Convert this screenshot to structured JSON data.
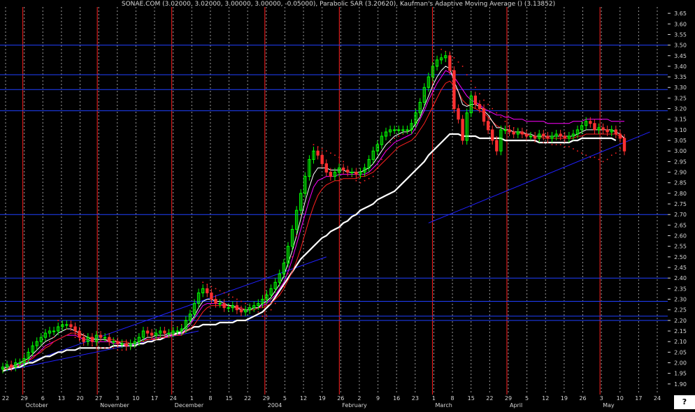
{
  "title": "SONAE.COM (3.02000, 3.02000, 3.00000, 3.00000, -0.05000), Parabolic SAR (3.20620), Kaufman's Adaptive Moving Average () (3.13852)",
  "help_label": "?",
  "colors": {
    "background": "#000000",
    "up_candle": "#00ff00",
    "down_candle": "#ff3030",
    "grid_vertical": "#9a9a9a",
    "grid_month": "#ff2020",
    "hline": "#2040ff",
    "sar": "#ff2020",
    "kama": "#ff00ff",
    "fast_ma": "#ffffff",
    "mid_ma": "#ff2020",
    "slow_ma": "#ffffff",
    "trendline": "#2020ff",
    "axis_text": "#d8d8d8"
  },
  "chart_data": {
    "type": "candlestick",
    "title": "SONAE.COM (3.02000, 3.02000, 3.00000, 3.00000, -0.05000), Parabolic SAR (3.20620), Kaufman's Adaptive Moving Average () (3.13852)",
    "ylim": [
      1.85,
      3.68
    ],
    "y_ticks": [
      "3.65",
      "3.60",
      "3.55",
      "3.50",
      "3.45",
      "3.40",
      "3.35",
      "3.30",
      "3.25",
      "3.20",
      "3.15",
      "3.10",
      "3.05",
      "3.00",
      "2.95",
      "2.90",
      "2.85",
      "2.80",
      "2.75",
      "2.70",
      "2.65",
      "2.60",
      "2.55",
      "2.50",
      "2.45",
      "2.40",
      "2.35",
      "2.30",
      "2.25",
      "2.20",
      "2.15",
      "2.10",
      "2.05",
      "2.00",
      "1.95",
      "1.90"
    ],
    "x_day_labels": [
      "22",
      "29",
      "6",
      "13",
      "20",
      "27",
      "3",
      "10",
      "17",
      "24",
      "1",
      "8",
      "15",
      "22",
      "29",
      "5",
      "12",
      "19",
      "26",
      "2",
      "9",
      "16",
      "23",
      "1",
      "8",
      "15",
      "22",
      "29",
      "5",
      "12",
      "19",
      "26",
      "3",
      "10",
      "17",
      "24"
    ],
    "x_month_labels": [
      "October",
      "November",
      "December",
      "2004",
      "February",
      "March",
      "April",
      "May"
    ],
    "horizontal_levels": [
      3.5,
      3.36,
      3.29,
      3.19,
      2.7,
      2.4,
      2.29,
      2.22,
      2.2
    ],
    "closes": [
      1.98,
      1.99,
      1.98,
      2.0,
      2.0,
      2.02,
      2.05,
      2.08,
      2.1,
      2.12,
      2.14,
      2.15,
      2.15,
      2.17,
      2.18,
      2.18,
      2.17,
      2.15,
      2.12,
      2.1,
      2.12,
      2.1,
      2.13,
      2.12,
      2.12,
      2.1,
      2.1,
      2.09,
      2.09,
      2.08,
      2.09,
      2.1,
      2.12,
      2.15,
      2.14,
      2.13,
      2.14,
      2.15,
      2.14,
      2.14,
      2.15,
      2.15,
      2.16,
      2.2,
      2.23,
      2.28,
      2.33,
      2.35,
      2.33,
      2.3,
      2.28,
      2.28,
      2.26,
      2.26,
      2.27,
      2.25,
      2.24,
      2.25,
      2.26,
      2.27,
      2.28,
      2.3,
      2.32,
      2.35,
      2.38,
      2.42,
      2.47,
      2.55,
      2.63,
      2.72,
      2.8,
      2.88,
      2.96,
      3.0,
      2.98,
      2.94,
      2.9,
      2.88,
      2.9,
      2.92,
      2.91,
      2.9,
      2.9,
      2.89,
      2.9,
      2.92,
      2.96,
      3.0,
      3.03,
      3.07,
      3.09,
      3.1,
      3.1,
      3.1,
      3.1,
      3.1,
      3.13,
      3.18,
      3.23,
      3.3,
      3.35,
      3.4,
      3.43,
      3.44,
      3.45,
      3.38,
      3.2,
      3.15,
      3.05,
      3.18,
      3.26,
      3.22,
      3.2,
      3.14,
      3.1,
      3.05,
      3.0,
      3.1,
      3.1,
      3.09,
      3.08,
      3.09,
      3.08,
      3.07,
      3.07,
      3.06,
      3.08,
      3.07,
      3.06,
      3.07,
      3.08,
      3.07,
      3.06,
      3.07,
      3.08,
      3.1,
      3.12,
      3.14,
      3.13,
      3.1,
      3.11,
      3.1,
      3.09,
      3.1,
      3.08,
      3.06,
      3.0
    ],
    "sar": [
      1.96,
      1.97,
      1.98,
      1.99,
      2.0,
      2.01,
      2.02,
      2.03,
      2.04,
      2.06,
      2.08,
      2.1,
      2.12,
      2.2,
      2.18,
      2.16,
      2.14,
      2.12,
      2.11,
      2.1,
      2.09,
      2.08,
      2.07,
      2.07,
      2.07,
      2.07,
      2.07,
      2.06,
      2.06,
      2.06,
      2.07,
      2.08,
      2.09,
      2.1,
      2.11,
      2.12,
      2.12,
      2.13,
      2.14,
      2.15,
      2.16,
      2.17,
      2.18,
      2.2,
      2.22,
      2.25,
      2.28,
      2.38,
      2.37,
      2.36,
      2.35,
      2.34,
      2.33,
      2.32,
      2.31,
      2.3,
      2.29,
      2.28,
      2.27,
      2.26,
      2.24,
      2.22,
      2.22,
      2.25,
      2.28,
      2.32,
      2.36,
      2.42,
      2.5,
      2.6,
      2.7,
      2.8,
      2.88,
      3.03,
      3.02,
      3.01,
      3.0,
      2.99,
      2.98,
      2.97,
      2.95,
      2.9,
      2.88,
      2.86,
      2.85,
      2.86,
      2.87,
      2.88,
      2.92,
      2.96,
      3.0,
      3.04,
      3.06,
      3.07,
      3.08,
      3.09,
      3.1,
      3.14,
      3.2,
      3.26,
      3.3,
      3.36,
      3.4,
      3.48,
      3.47,
      3.46,
      3.44,
      3.42,
      3.4,
      3.36,
      3.33,
      3.3,
      3.27,
      3.24,
      3.22,
      3.2,
      3.18,
      3.16,
      3.14,
      3.12,
      3.11,
      3.1,
      3.09,
      3.08,
      3.07,
      3.06,
      3.05,
      3.04,
      3.04,
      3.03,
      3.03,
      3.03,
      3.02,
      3.02,
      3.01,
      3.0,
      2.99,
      2.98,
      2.97,
      2.97,
      2.96,
      2.95,
      2.96,
      2.98,
      2.99,
      3.01,
      3.03
    ],
    "kama": [
      1.98,
      1.98,
      1.98,
      1.99,
      1.99,
      2.0,
      2.01,
      2.03,
      2.04,
      2.06,
      2.08,
      2.09,
      2.1,
      2.11,
      2.12,
      2.13,
      2.13,
      2.13,
      2.12,
      2.11,
      2.11,
      2.1,
      2.1,
      2.1,
      2.1,
      2.1,
      2.09,
      2.09,
      2.09,
      2.08,
      2.08,
      2.09,
      2.1,
      2.11,
      2.11,
      2.11,
      2.12,
      2.12,
      2.12,
      2.13,
      2.13,
      2.13,
      2.14,
      2.16,
      2.18,
      2.21,
      2.24,
      2.27,
      2.28,
      2.28,
      2.28,
      2.28,
      2.27,
      2.27,
      2.27,
      2.26,
      2.26,
      2.25,
      2.25,
      2.26,
      2.26,
      2.27,
      2.28,
      2.3,
      2.32,
      2.35,
      2.38,
      2.43,
      2.49,
      2.56,
      2.63,
      2.7,
      2.77,
      2.83,
      2.86,
      2.87,
      2.88,
      2.88,
      2.88,
      2.89,
      2.89,
      2.89,
      2.89,
      2.89,
      2.89,
      2.89,
      2.9,
      2.92,
      2.94,
      2.97,
      3.0,
      3.02,
      3.04,
      3.05,
      3.06,
      3.07,
      3.08,
      3.11,
      3.15,
      3.19,
      3.24,
      3.28,
      3.32,
      3.35,
      3.38,
      3.37,
      3.35,
      3.32,
      3.29,
      3.26,
      3.24,
      3.23,
      3.22,
      3.2,
      3.19,
      3.18,
      3.17,
      3.17,
      3.16,
      3.16,
      3.15,
      3.15,
      3.15,
      3.14,
      3.14,
      3.14,
      3.14,
      3.14,
      3.13,
      3.13,
      3.13,
      3.13,
      3.13,
      3.13,
      3.14,
      3.14,
      3.14,
      3.15,
      3.15,
      3.15,
      3.15,
      3.15,
      3.15,
      3.14,
      3.14,
      3.14,
      3.14
    ],
    "fast_ma": [
      1.97,
      1.98,
      1.98,
      1.99,
      2.0,
      2.01,
      2.02,
      2.04,
      2.06,
      2.08,
      2.1,
      2.11,
      2.12,
      2.14,
      2.15,
      2.16,
      2.16,
      2.15,
      2.14,
      2.13,
      2.12,
      2.11,
      2.11,
      2.11,
      2.11,
      2.1,
      2.1,
      2.1,
      2.09,
      2.09,
      2.09,
      2.09,
      2.1,
      2.11,
      2.12,
      2.12,
      2.13,
      2.13,
      2.13,
      2.14,
      2.14,
      2.14,
      2.15,
      2.17,
      2.19,
      2.22,
      2.26,
      2.29,
      2.3,
      2.3,
      2.29,
      2.29,
      2.28,
      2.27,
      2.27,
      2.26,
      2.25,
      2.25,
      2.25,
      2.26,
      2.26,
      2.28,
      2.29,
      2.31,
      2.34,
      2.37,
      2.41,
      2.47,
      2.53,
      2.6,
      2.68,
      2.76,
      2.83,
      2.89,
      2.92,
      2.92,
      2.92,
      2.91,
      2.91,
      2.91,
      2.91,
      2.9,
      2.9,
      2.9,
      2.9,
      2.91,
      2.92,
      2.94,
      2.97,
      3.0,
      3.03,
      3.05,
      3.07,
      3.08,
      3.09,
      3.09,
      3.1,
      3.13,
      3.16,
      3.21,
      3.26,
      3.31,
      3.35,
      3.38,
      3.4,
      3.39,
      3.33,
      3.28,
      3.22,
      3.21,
      3.22,
      3.22,
      3.21,
      3.19,
      3.17,
      3.14,
      3.11,
      3.11,
      3.1,
      3.1,
      3.09,
      3.09,
      3.09,
      3.08,
      3.08,
      3.07,
      3.07,
      3.07,
      3.07,
      3.07,
      3.07,
      3.07,
      3.07,
      3.07,
      3.07,
      3.08,
      3.09,
      3.1,
      3.1,
      3.1,
      3.1,
      3.1,
      3.1,
      3.1,
      3.09,
      3.08,
      3.06
    ],
    "mid_ma": [
      1.97,
      1.97,
      1.98,
      1.98,
      1.99,
      2.0,
      2.01,
      2.02,
      2.04,
      2.05,
      2.07,
      2.08,
      2.1,
      2.11,
      2.12,
      2.13,
      2.14,
      2.14,
      2.13,
      2.13,
      2.12,
      2.12,
      2.11,
      2.11,
      2.11,
      2.11,
      2.11,
      2.1,
      2.1,
      2.1,
      2.09,
      2.09,
      2.1,
      2.1,
      2.11,
      2.11,
      2.11,
      2.12,
      2.12,
      2.12,
      2.13,
      2.13,
      2.13,
      2.15,
      2.16,
      2.18,
      2.21,
      2.24,
      2.26,
      2.27,
      2.27,
      2.27,
      2.27,
      2.27,
      2.26,
      2.26,
      2.26,
      2.25,
      2.25,
      2.25,
      2.26,
      2.26,
      2.27,
      2.28,
      2.3,
      2.32,
      2.35,
      2.39,
      2.43,
      2.48,
      2.54,
      2.61,
      2.68,
      2.74,
      2.79,
      2.82,
      2.84,
      2.85,
      2.86,
      2.86,
      2.87,
      2.87,
      2.87,
      2.87,
      2.88,
      2.88,
      2.89,
      2.9,
      2.92,
      2.94,
      2.96,
      2.98,
      3.0,
      3.02,
      3.03,
      3.04,
      3.05,
      3.07,
      3.1,
      3.13,
      3.17,
      3.21,
      3.25,
      3.29,
      3.32,
      3.33,
      3.31,
      3.28,
      3.24,
      3.22,
      3.21,
      3.2,
      3.19,
      3.18,
      3.16,
      3.14,
      3.12,
      3.11,
      3.1,
      3.1,
      3.09,
      3.09,
      3.08,
      3.08,
      3.07,
      3.07,
      3.07,
      3.06,
      3.06,
      3.06,
      3.06,
      3.06,
      3.06,
      3.06,
      3.06,
      3.07,
      3.07,
      3.08,
      3.08,
      3.08,
      3.08,
      3.08,
      3.08,
      3.08,
      3.08,
      3.07,
      3.06
    ],
    "slow_ma": [
      1.96,
      1.97,
      1.97,
      1.98,
      1.98,
      1.99,
      2.0,
      2.0,
      2.01,
      2.02,
      2.03,
      2.03,
      2.04,
      2.05,
      2.05,
      2.06,
      2.06,
      2.06,
      2.07,
      2.07,
      2.07,
      2.07,
      2.07,
      2.07,
      2.07,
      2.07,
      2.08,
      2.08,
      2.08,
      2.08,
      2.08,
      2.08,
      2.09,
      2.09,
      2.1,
      2.1,
      2.11,
      2.11,
      2.12,
      2.13,
      2.13,
      2.14,
      2.14,
      2.15,
      2.16,
      2.17,
      2.17,
      2.18,
      2.18,
      2.18,
      2.18,
      2.19,
      2.19,
      2.19,
      2.19,
      2.2,
      2.2,
      2.2,
      2.21,
      2.22,
      2.23,
      2.24,
      2.26,
      2.28,
      2.31,
      2.34,
      2.37,
      2.4,
      2.43,
      2.46,
      2.49,
      2.51,
      2.53,
      2.55,
      2.57,
      2.59,
      2.6,
      2.62,
      2.63,
      2.64,
      2.66,
      2.67,
      2.69,
      2.7,
      2.72,
      2.73,
      2.74,
      2.75,
      2.77,
      2.78,
      2.79,
      2.8,
      2.81,
      2.83,
      2.85,
      2.87,
      2.89,
      2.91,
      2.93,
      2.95,
      2.98,
      3.0,
      3.02,
      3.04,
      3.06,
      3.08,
      3.08,
      3.08,
      3.07,
      3.07,
      3.07,
      3.07,
      3.06,
      3.06,
      3.06,
      3.06,
      3.06,
      3.06,
      3.05,
      3.05,
      3.05,
      3.05,
      3.05,
      3.05,
      3.05,
      3.05,
      3.04,
      3.04,
      3.04,
      3.04,
      3.04,
      3.04,
      3.04,
      3.04,
      3.05,
      3.05,
      3.06,
      3.06,
      3.06,
      3.06,
      3.06,
      3.06,
      3.06,
      3.06,
      3.05
    ]
  }
}
